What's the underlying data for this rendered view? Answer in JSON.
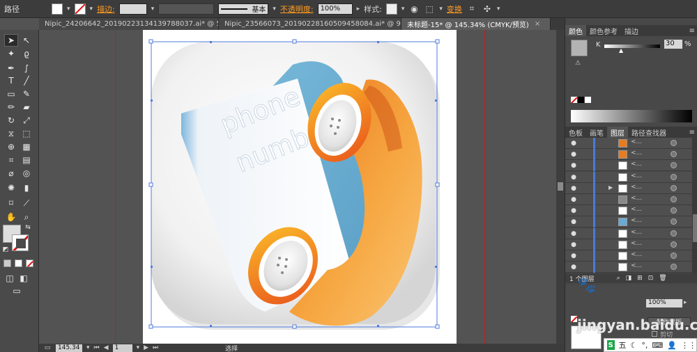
{
  "control_bar": {
    "selection_label": "路径",
    "stroke_label": "描边:",
    "stroke_style": "基本",
    "opacity_label": "不透明度:",
    "opacity_value": "100%",
    "style_label": "样式:",
    "transform_label": "变换"
  },
  "tabs": [
    {
      "label": "Nipic_24206642_20190223134139788037.ai* @ 50...",
      "active": false
    },
    {
      "label": "Nipic_23566073_20190228160509458084.ai* @ 98...",
      "active": false
    },
    {
      "label": "未标题-15* @ 145.34% (CMYK/预览)",
      "active": true
    }
  ],
  "artwork": {
    "text_line1": "phone",
    "text_line2": "number"
  },
  "status_bar": {
    "zoom": "145.34",
    "page": "1",
    "tool": "选择"
  },
  "color_panel": {
    "tabs": [
      "颜色",
      "颜色参考",
      "描边"
    ],
    "channel": "K",
    "value": "30",
    "unit": "%"
  },
  "layers_panel": {
    "tabs": [
      "色板",
      "画笔",
      "图层",
      "路径查找器"
    ],
    "item_label": "<...",
    "row_count": 12,
    "layer_count": "1 个图层"
  },
  "transparency_panel": {
    "opacity": "100%",
    "mask_button": "制作蒙版",
    "clip_label": "剪切"
  },
  "watermark": {
    "text": "jingyan.baidu.com"
  },
  "ime": {
    "label": "五"
  },
  "colors": {
    "accent": "#ff9b21",
    "handset_orange": "#f39a34",
    "book_blue": "#6eb1d4"
  }
}
